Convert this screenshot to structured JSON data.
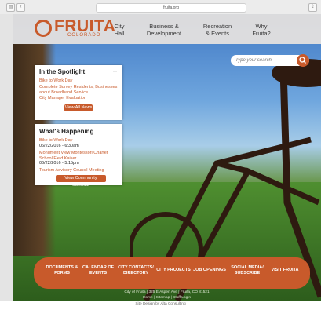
{
  "browser": {
    "url": "fruita.org"
  },
  "logo": {
    "name": "FRUITA",
    "subtitle": "COLORADO"
  },
  "nav": [
    {
      "label": "City\nHall"
    },
    {
      "label": "Business &\nDevelopment"
    },
    {
      "label": "Recreation\n& Events"
    },
    {
      "label": "Why\nFruita?"
    }
  ],
  "search": {
    "placeholder": "Type your search"
  },
  "spotlight": {
    "title": "In the Spotlight",
    "items": [
      "Bike to Work Day",
      "Complete Survey Residents, Businesses about Broadband Service",
      "City Manager Evaluation"
    ],
    "view_all": "View All News"
  },
  "happening": {
    "title": "What's Happening",
    "events": [
      {
        "name": "Bike to Work Day",
        "date": "06/22/2016 - 6:30am"
      },
      {
        "name": "Monument View Montessori Charter School Field Kaiser",
        "date": "06/22/2016 - 5:15pm"
      },
      {
        "name": "Tourism Advisory Council Meeting",
        "date": ""
      }
    ],
    "view_calendar": "View Community Calendar"
  },
  "bottom_nav": [
    "DOCUMENTS &\nFORMS",
    "CALENDAR OF\nEVENTS",
    "CITY CONTACTS/\nDIRECTORY",
    "CITY PROJECTS",
    "JOB OPENINGS",
    "SOCIAL MEDIA/\nSUBSCRIBE",
    "VISIT FRUITA"
  ],
  "footer": {
    "address": "City of Fruita | 325 E Aspen Ave | Fruita, CO 81521",
    "links": "Home | Sitemap | Staff Login",
    "credit": "Site Design by Alta Consulting"
  },
  "colors": {
    "accent": "#c85a2b",
    "nav_bg": "#f0e8e0"
  }
}
